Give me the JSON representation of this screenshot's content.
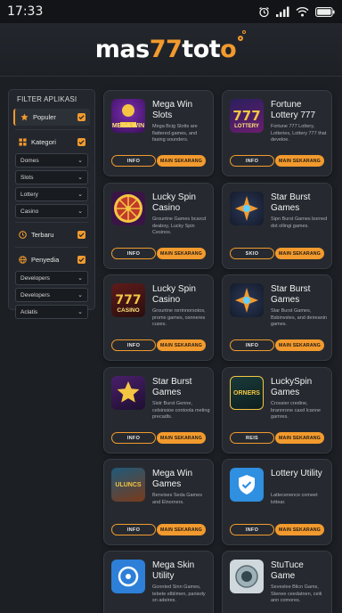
{
  "status": {
    "time": "17:33"
  },
  "logo": {
    "part1": "mas",
    "part2": "77",
    "part3": "tot",
    "part4": "o"
  },
  "sidebar": {
    "title": "FILTER APLIKASI",
    "popular": "Populer",
    "category": "Kategori",
    "category_selects": [
      "Domes",
      "Slots",
      "Lottery",
      "Casino"
    ],
    "latest": "Terbaru",
    "provider": "Penyedia",
    "provider_selects": [
      "Developers",
      "Developers",
      "Aclatis"
    ]
  },
  "cards": [
    {
      "title": "Mega Win Slots",
      "desc": "Mega Bcig Slotts are flattered games, and fasing sounders.",
      "info": "INFO",
      "play": "MAIN SEKARANG",
      "thumb": "mega-win",
      "thumb_text": "MEGA WIN"
    },
    {
      "title": "Fortune Lottery 777",
      "desc": "Fortune 777 Lottery, Lotteries, Lottery 777 that develoe.",
      "info": "INFO",
      "play": "MAIN SEKARANG",
      "thumb": "lottery",
      "thumb_text": "LOTTERY"
    },
    {
      "title": "Lucky Spin Casino",
      "desc": "Grountne Games bcarcd deaboy, Lucky Spin Cesinos.",
      "info": "INFO",
      "play": "MAIN SEKARANG",
      "thumb": "wheel"
    },
    {
      "title": "Star Burst Games",
      "desc": "Sipn Burst Games borned dot ollingi games.",
      "info": "SKIO",
      "play": "MAIN SEKARANG",
      "thumb": "star"
    },
    {
      "title": "Lucky Spin Casino",
      "desc": "Grountne rsrrinnorsotos, promo games, osnneres cuses.",
      "info": "INFO",
      "play": "MAIN SEKARANG",
      "thumb": "casino",
      "thumb_text": "CASINO"
    },
    {
      "title": "Star Burst Games",
      "desc": "Star Burst Games, Bsbinvstes, and deireanin games.",
      "info": "INFO",
      "play": "MAIN SEKARANG",
      "thumb": "star"
    },
    {
      "title": "Star Burst Games",
      "desc": "Sistr Burst Genne, celsinsioe contoola meting precadls.",
      "info": "INFO",
      "play": "MAIN SEKARANG",
      "thumb": "starburst"
    },
    {
      "title": "LuckySpin Games",
      "desc": "Crossier credine, brannrone caxd lcanne gamres.",
      "info": "REIS",
      "play": "MAIN SEKARANG",
      "thumb": "luckyspin",
      "thumb_text": "ORNERS"
    },
    {
      "title": "Mega Win Games",
      "desc": "Benvises Seda Games and Elnorners.",
      "info": "INFO",
      "play": "MAIN SEKARANG",
      "thumb": "megawin2",
      "thumb_text": "ULUNCS"
    },
    {
      "title": "Lottery Utility",
      "desc": "Lattecenence comeet lottear.",
      "info": "INFO",
      "play": "MAIN SEKARANG",
      "thumb": "shield"
    },
    {
      "title": "Mega Skin Utility",
      "desc": "Gonnted Sinn Games, tebete elblimen, paniedy sn adeires.",
      "info": "",
      "play": "",
      "thumb": "bluecircle"
    },
    {
      "title": "StuTuce Game",
      "desc": "Seveslee Blicn Gams, Stenee ceedatnen, ceili ann comores.",
      "info": "",
      "play": "",
      "thumb": "dial"
    }
  ],
  "colors": {
    "accent": "#f29a2e",
    "bg": "#1c1f24",
    "card": "#262a30"
  }
}
